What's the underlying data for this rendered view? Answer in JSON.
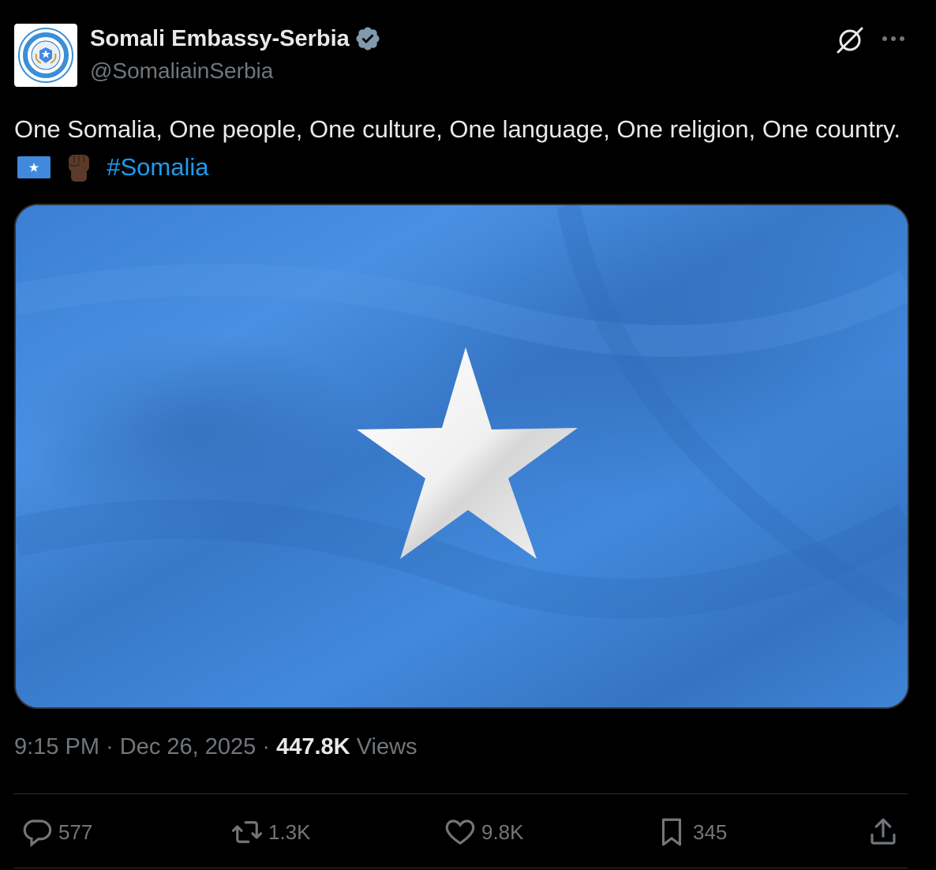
{
  "author": {
    "name": "Somali Embassy-Serbia",
    "handle": "@SomaliainSerbia",
    "verified_color": "#829aab"
  },
  "tweet": {
    "text": "One Somalia, One people, One culture, One language, One religion, One country.",
    "emojis": [
      "somalia-flag-emoji",
      "raised-fist-emoji"
    ],
    "hashtag": "#Somalia"
  },
  "media": {
    "alt": "Flag of Somalia",
    "flag_color": "#4189dd",
    "star_color": "#ffffff"
  },
  "meta": {
    "time": "9:15 PM",
    "separator": "·",
    "date": "Dec 26, 2025",
    "views_count": "447.8K",
    "views_label": "Views"
  },
  "actions": {
    "replies": "577",
    "reposts": "1.3K",
    "likes": "9.8K",
    "bookmarks": "345"
  },
  "colors": {
    "background": "#000000",
    "text": "#e7e9ea",
    "secondary": "#71767b",
    "link": "#1d9bf0",
    "divider": "#2f3336"
  }
}
